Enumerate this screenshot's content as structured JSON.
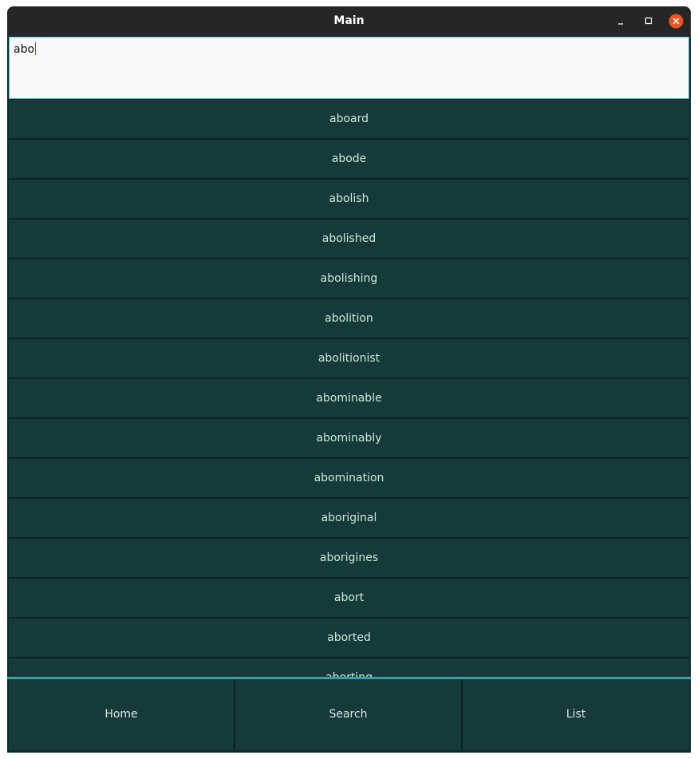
{
  "window": {
    "title": "Main",
    "controls": [
      "minimize-icon",
      "maximize-icon",
      "close-icon"
    ]
  },
  "search": {
    "value": "abo"
  },
  "results": [
    "aboard",
    "abode",
    "abolish",
    "abolished",
    "abolishing",
    "abolition",
    "abolitionist",
    "abominable",
    "abominably",
    "abomination",
    "aboriginal",
    "aborigines",
    "abort",
    "aborted",
    "aborting"
  ],
  "nav": {
    "home": "Home",
    "search": "Search",
    "list": "List"
  },
  "colors": {
    "accent": "#35a3a6",
    "row_background": "#163a3a",
    "row_text": "#c9ead7",
    "close_button": "#e95420"
  }
}
